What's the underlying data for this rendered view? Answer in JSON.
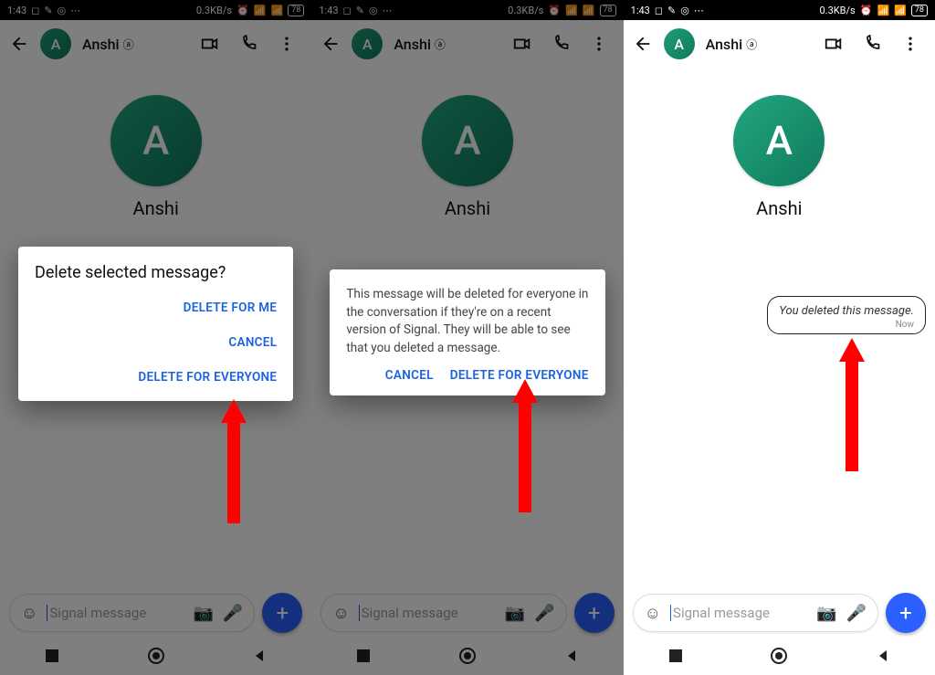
{
  "status": {
    "time": "1:43",
    "netspeed": "0.3KB/s",
    "battery": "78"
  },
  "header": {
    "contact_name": "Anshi",
    "avatar_initial": "A"
  },
  "body": {
    "avatar_initial": "A",
    "contact_name": "Anshi"
  },
  "compose": {
    "placeholder": "Signal message"
  },
  "dialog1": {
    "title": "Delete selected message?",
    "actions": {
      "delete_for_me": "DELETE FOR ME",
      "cancel": "CANCEL",
      "delete_for_everyone": "DELETE FOR EVERYONE"
    }
  },
  "dialog2": {
    "body": "This message will be deleted for everyone in the conversation if they're on a recent version of Signal. They will be able to see that you deleted a message.",
    "actions": {
      "cancel": "CANCEL",
      "delete_for_everyone": "DELETE FOR EVERYONE"
    }
  },
  "deleted": {
    "text": "You deleted this message.",
    "time": "Now"
  }
}
